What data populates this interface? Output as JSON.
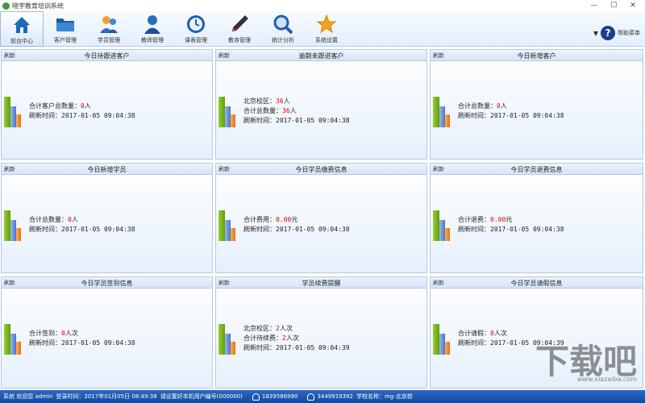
{
  "titlebar": {
    "title": "晓宇教育培训系统",
    "minimize": "—",
    "maximize": "☐",
    "close": "✕"
  },
  "toolbar": {
    "items": [
      {
        "label": "前台中心",
        "icon": "home-icon"
      },
      {
        "label": "客户管理",
        "icon": "folder-icon"
      },
      {
        "label": "学员管理",
        "icon": "students-icon"
      },
      {
        "label": "教师管理",
        "icon": "teacher-icon"
      },
      {
        "label": "课表管理",
        "icon": "clock-icon"
      },
      {
        "label": "教务管理",
        "icon": "pen-icon"
      },
      {
        "label": "统计分析",
        "icon": "magnifier-icon"
      },
      {
        "label": "系统设置",
        "icon": "star-icon"
      }
    ],
    "help_label": "帮助菜单",
    "help_icon": "?"
  },
  "panels": [
    {
      "title": "今日待跟进客户",
      "refresh": "刷新",
      "line1_label": "合计客户总数量：",
      "line1_value": "0",
      "line1_unit": "人",
      "line2_label": "刷新时间：",
      "line2_value": "2017-01-05 09:04:38"
    },
    {
      "title": "逾期未跟进客户",
      "refresh": "刷新",
      "line1_label": "北京校区：",
      "line1_value": "36",
      "line1_unit": "人",
      "line2_label": "合计总数量：",
      "line2_value": "36",
      "line2_unit": "人",
      "line3_label": "刷新时间：",
      "line3_value": "2017-01-05 09:04:38"
    },
    {
      "title": "今日新增客户",
      "refresh": "刷新",
      "line1_label": "合计总数量：",
      "line1_value": "0",
      "line1_unit": "人",
      "line2_label": "刷新时间：",
      "line2_value": "2017-01-05 09:04:38"
    },
    {
      "title": "今日新增学员",
      "refresh": "刷新",
      "line1_label": "合计总数量：",
      "line1_value": "0",
      "line1_unit": "人",
      "line2_label": "刷新时间：",
      "line2_value": "2017-01-05 09:04:38"
    },
    {
      "title": "今日学员缴费信息",
      "refresh": "刷新",
      "line1_label": "合计费用：",
      "line1_value": "0.00",
      "line1_unit": "元",
      "line2_label": "刷新时间：",
      "line2_value": "2017-01-05 09:04:38"
    },
    {
      "title": "今日学员退费信息",
      "refresh": "刷新",
      "line1_label": "合计退费：",
      "line1_value": "0.00",
      "line1_unit": "元",
      "line2_label": "刷新时间：",
      "line2_value": "2017-01-05 09:04:38"
    },
    {
      "title": "今日学员签到信息",
      "refresh": "刷新",
      "line1_label": "合计签到：",
      "line1_value": "0",
      "line1_unit": "人次",
      "line2_label": "刷新时间：",
      "line2_value": "2017-01-05 09:04:38"
    },
    {
      "title": "学员续费提醒",
      "refresh": "刷新",
      "line1_label": "北京校区：",
      "line1_value": "2",
      "line1_unit": "人次",
      "line2_label": "合计待续费：",
      "line2_value": "2",
      "line2_unit": "人次",
      "line3_label": "刷新时间：",
      "line3_value": "2017-01-05 09:04:39"
    },
    {
      "title": "今日学员请假信息",
      "refresh": "刷新",
      "line1_label": "合计请假：",
      "line1_value": "0",
      "line1_unit": "人次",
      "line2_label": "刷新时间：",
      "line2_value": "2017-01-05 09:04:39"
    }
  ],
  "status": {
    "user": "系统 欢迎您 admin",
    "login_time": "登录时间：2017年01月05日 08:49:38",
    "notice": "请设置好本机用户编号(000000)",
    "phone1": "1839586990",
    "phone2": "3449919392",
    "school": "学校名称：mg-北京校"
  },
  "watermark": {
    "text": "下载吧",
    "sub": "www.xiazaiba.com"
  },
  "colors": {
    "accent": "#1c5bb5",
    "red_value": "#e00000",
    "bar_green": "#7ab51d",
    "bar_blue": "#6d8fd3",
    "bar_orange": "#f28a23"
  }
}
